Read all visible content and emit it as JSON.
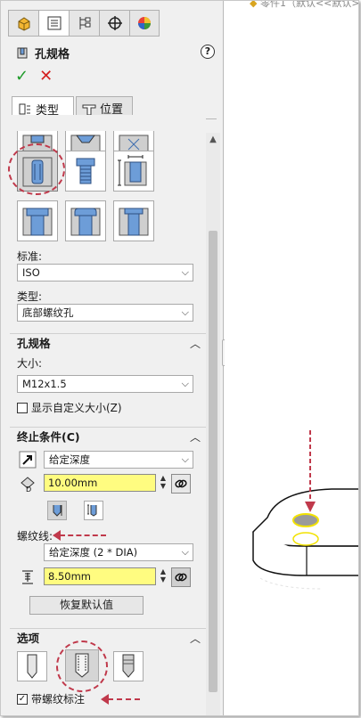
{
  "tabs": [
    {
      "icon": "part-feature-icon"
    },
    {
      "icon": "property-manager-icon"
    },
    {
      "icon": "configuration-manager-icon"
    },
    {
      "icon": "dimxpert-icon"
    },
    {
      "icon": "display-manager-icon"
    }
  ],
  "title": "孔规格",
  "help_icon": "?",
  "ok_icon": "✓",
  "cancel_icon": "✕",
  "subtabs": {
    "type": "类型",
    "position": "位置"
  },
  "hole_types": {
    "row1": [
      "counterbore-hole-icon",
      "countersink-hole-icon",
      "straight-hole-icon"
    ],
    "row2": [
      "bottom-tapped-hole-icon",
      "tapped-hole-icon",
      "pipe-tap-icon"
    ],
    "row3": [
      "legacy-hole-icon",
      "counterbore-slot-icon",
      "straight-slot-icon"
    ],
    "selected": "bottom-tapped-hole-icon"
  },
  "standard": {
    "label": "标准:",
    "value": "ISO"
  },
  "type": {
    "label": "类型:",
    "value": "底部螺纹孔"
  },
  "spec_section": {
    "title": "孔规格",
    "size_label": "大小:",
    "size_value": "M12x1.5",
    "custom_size_checkbox": "显示自定义大小(Z)",
    "custom_size_checked": false
  },
  "end_section": {
    "title": "终止条件(C)",
    "end_condition": "给定深度",
    "depth": "10.00mm",
    "thread_label": "螺纹线:",
    "thread_condition": "给定深度 (2 * DIA)",
    "thread_depth": "8.50mm",
    "restore_button": "恢复默认值"
  },
  "options_section": {
    "title": "选项",
    "option_icons": [
      "cosmetic-thread-none-icon",
      "cosmetic-thread-icon",
      "remove-thread-icon"
    ],
    "selected_option": "cosmetic-thread-icon",
    "thread_callout_checkbox": "带螺纹标注",
    "thread_callout_checked": true
  },
  "canvas": {
    "header_text": "零件1（默认<<默认>"
  },
  "colors": {
    "annotation": "#c0394b",
    "input_highlight": "#fffc80",
    "highlight_edge": "#f2e200"
  }
}
